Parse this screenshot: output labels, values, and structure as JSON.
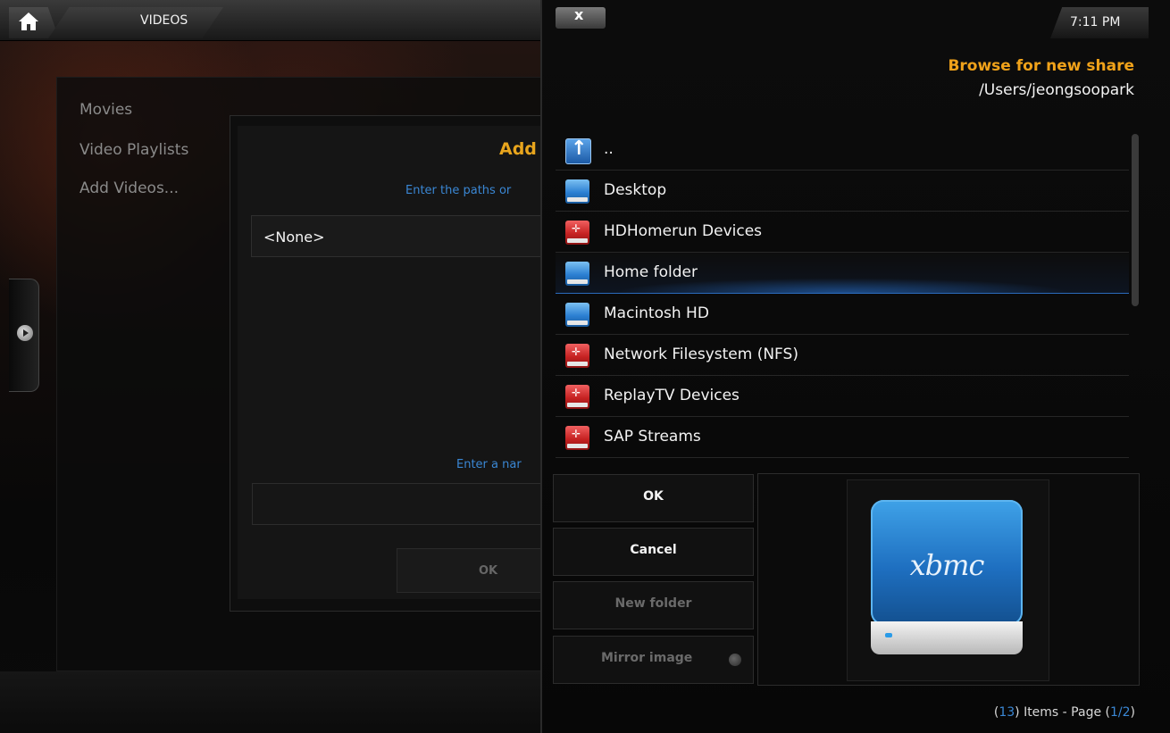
{
  "header": {
    "section_title": "VIDEOS",
    "clock": "7:11 PM"
  },
  "left_menu": {
    "items": [
      "Movies",
      "Video Playlists",
      "Add Videos..."
    ]
  },
  "add_source_dialog": {
    "title_visible": "Add",
    "hint_paths_visible": "Enter the paths or",
    "path_value": "<None>",
    "hint_name_visible": "Enter a nar",
    "ok_label": "OK"
  },
  "browser": {
    "close_label": "x",
    "title": "Browse for new share",
    "path": "/Users/jeongsoopark",
    "items": [
      {
        "label": "..",
        "icon": "parent-folder-icon"
      },
      {
        "label": "Desktop",
        "icon": "blue-drive-icon"
      },
      {
        "label": "HDHomerun Devices",
        "icon": "red-network-drive-icon"
      },
      {
        "label": "Home folder",
        "icon": "blue-drive-icon",
        "selected": true
      },
      {
        "label": "Macintosh HD",
        "icon": "blue-drive-icon"
      },
      {
        "label": "Network Filesystem (NFS)",
        "icon": "red-network-drive-icon"
      },
      {
        "label": "ReplayTV Devices",
        "icon": "red-network-drive-icon"
      },
      {
        "label": "SAP Streams",
        "icon": "red-network-drive-icon"
      }
    ],
    "buttons": {
      "ok": "OK",
      "cancel": "Cancel",
      "new_folder": "New folder",
      "mirror_image": "Mirror image"
    },
    "preview_logo": "xbmc",
    "footer": {
      "items_count": "13",
      "items_text": "Items - Page",
      "page": "1/2"
    }
  },
  "colors": {
    "accent_orange": "#f0a21a",
    "accent_blue": "#3a87d4"
  }
}
